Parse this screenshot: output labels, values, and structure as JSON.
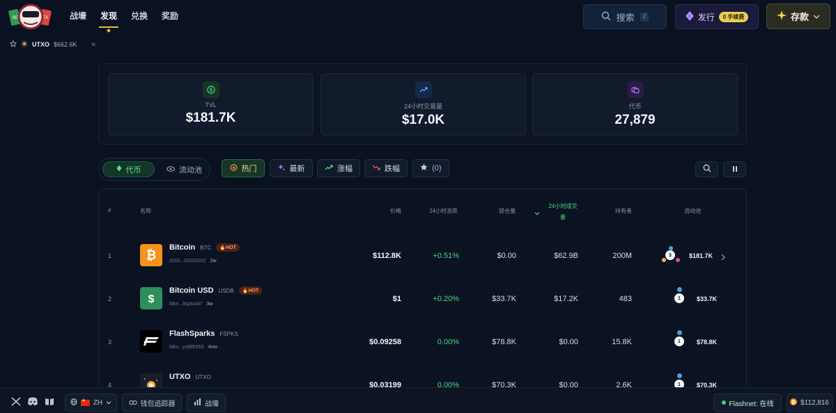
{
  "nav": {
    "items": [
      "战壕",
      "发现",
      "兑换",
      "奖励"
    ],
    "active_index": 1
  },
  "header": {
    "search_label": "搜索",
    "search_shortcut": "/",
    "issue_label": "发行",
    "fee_badge": "0 手续费",
    "deposit_label": "存款"
  },
  "ticker": {
    "symbol": "UTXO",
    "value": "$662.6K"
  },
  "stats": [
    {
      "label": "TVL",
      "value": "$181.7K",
      "icon": "dollar-icon",
      "color": "#4fd67f"
    },
    {
      "label": "24小时交易量",
      "value": "$17.0K",
      "icon": "trending-up-icon",
      "color": "#5fa4ff"
    },
    {
      "label": "代币",
      "value": "27,879",
      "icon": "coins-icon",
      "color": "#b07cff"
    }
  ],
  "filters": {
    "segment": {
      "tokens": "代币",
      "pools": "流动池"
    },
    "hot": "热门",
    "newest": "最新",
    "gainers": "涨幅",
    "losers": "跌幅",
    "favorites": "(0)"
  },
  "table": {
    "headers": {
      "rank": "#",
      "name": "名称",
      "price": "价格",
      "change": "24小时涨跌",
      "locked": "锁仓量",
      "volume_line1": "24小时成交",
      "volume_line2": "量",
      "holders": "持有者",
      "pool": "流动池"
    },
    "rows": [
      {
        "rank": "1",
        "name": "Bitcoin",
        "ticker": "BTC",
        "hot": "🔥HOT",
        "address": "0202...02020202",
        "age": "2w",
        "price": "$112.8K",
        "change": "+0.51%",
        "locked": "$0.00",
        "volume": "$62.9B",
        "holders": "200M",
        "pool_count": "3",
        "pool_value": "$181.7K"
      },
      {
        "rank": "2",
        "name": "Bitcoin USD",
        "ticker": "USDB",
        "hot": "🔥HOT",
        "address": "btkn...9qztux87",
        "age": "3w",
        "price": "$1",
        "change": "+0.20%",
        "locked": "$33.7K",
        "volume": "$17.2K",
        "holders": "483",
        "pool_count": "1",
        "pool_value": "$33.7K"
      },
      {
        "rank": "3",
        "name": "FlashSparks",
        "ticker": "FSPKS",
        "hot": "",
        "address": "btkn...ys86h553",
        "age": "4mo",
        "price": "$0.09258",
        "change": "0.00%",
        "locked": "$78.8K",
        "volume": "$0.00",
        "holders": "15.8K",
        "pool_count": "1",
        "pool_value": "$78.8K"
      },
      {
        "rank": "4",
        "name": "UTXO",
        "ticker": "UTXO",
        "hot": "",
        "address": "",
        "age": "",
        "price": "$0.03199",
        "change": "0.00%",
        "locked": "$70.3K",
        "volume": "$0.00",
        "holders": "2.6K",
        "pool_count": "1",
        "pool_value": "$70.3K"
      }
    ]
  },
  "bottom": {
    "language": "ZH",
    "wallet_tracker": "钱包追踪器",
    "trenches": "战壕",
    "network_status": "Flashnet: 在线",
    "btc_price": "$112,816"
  }
}
